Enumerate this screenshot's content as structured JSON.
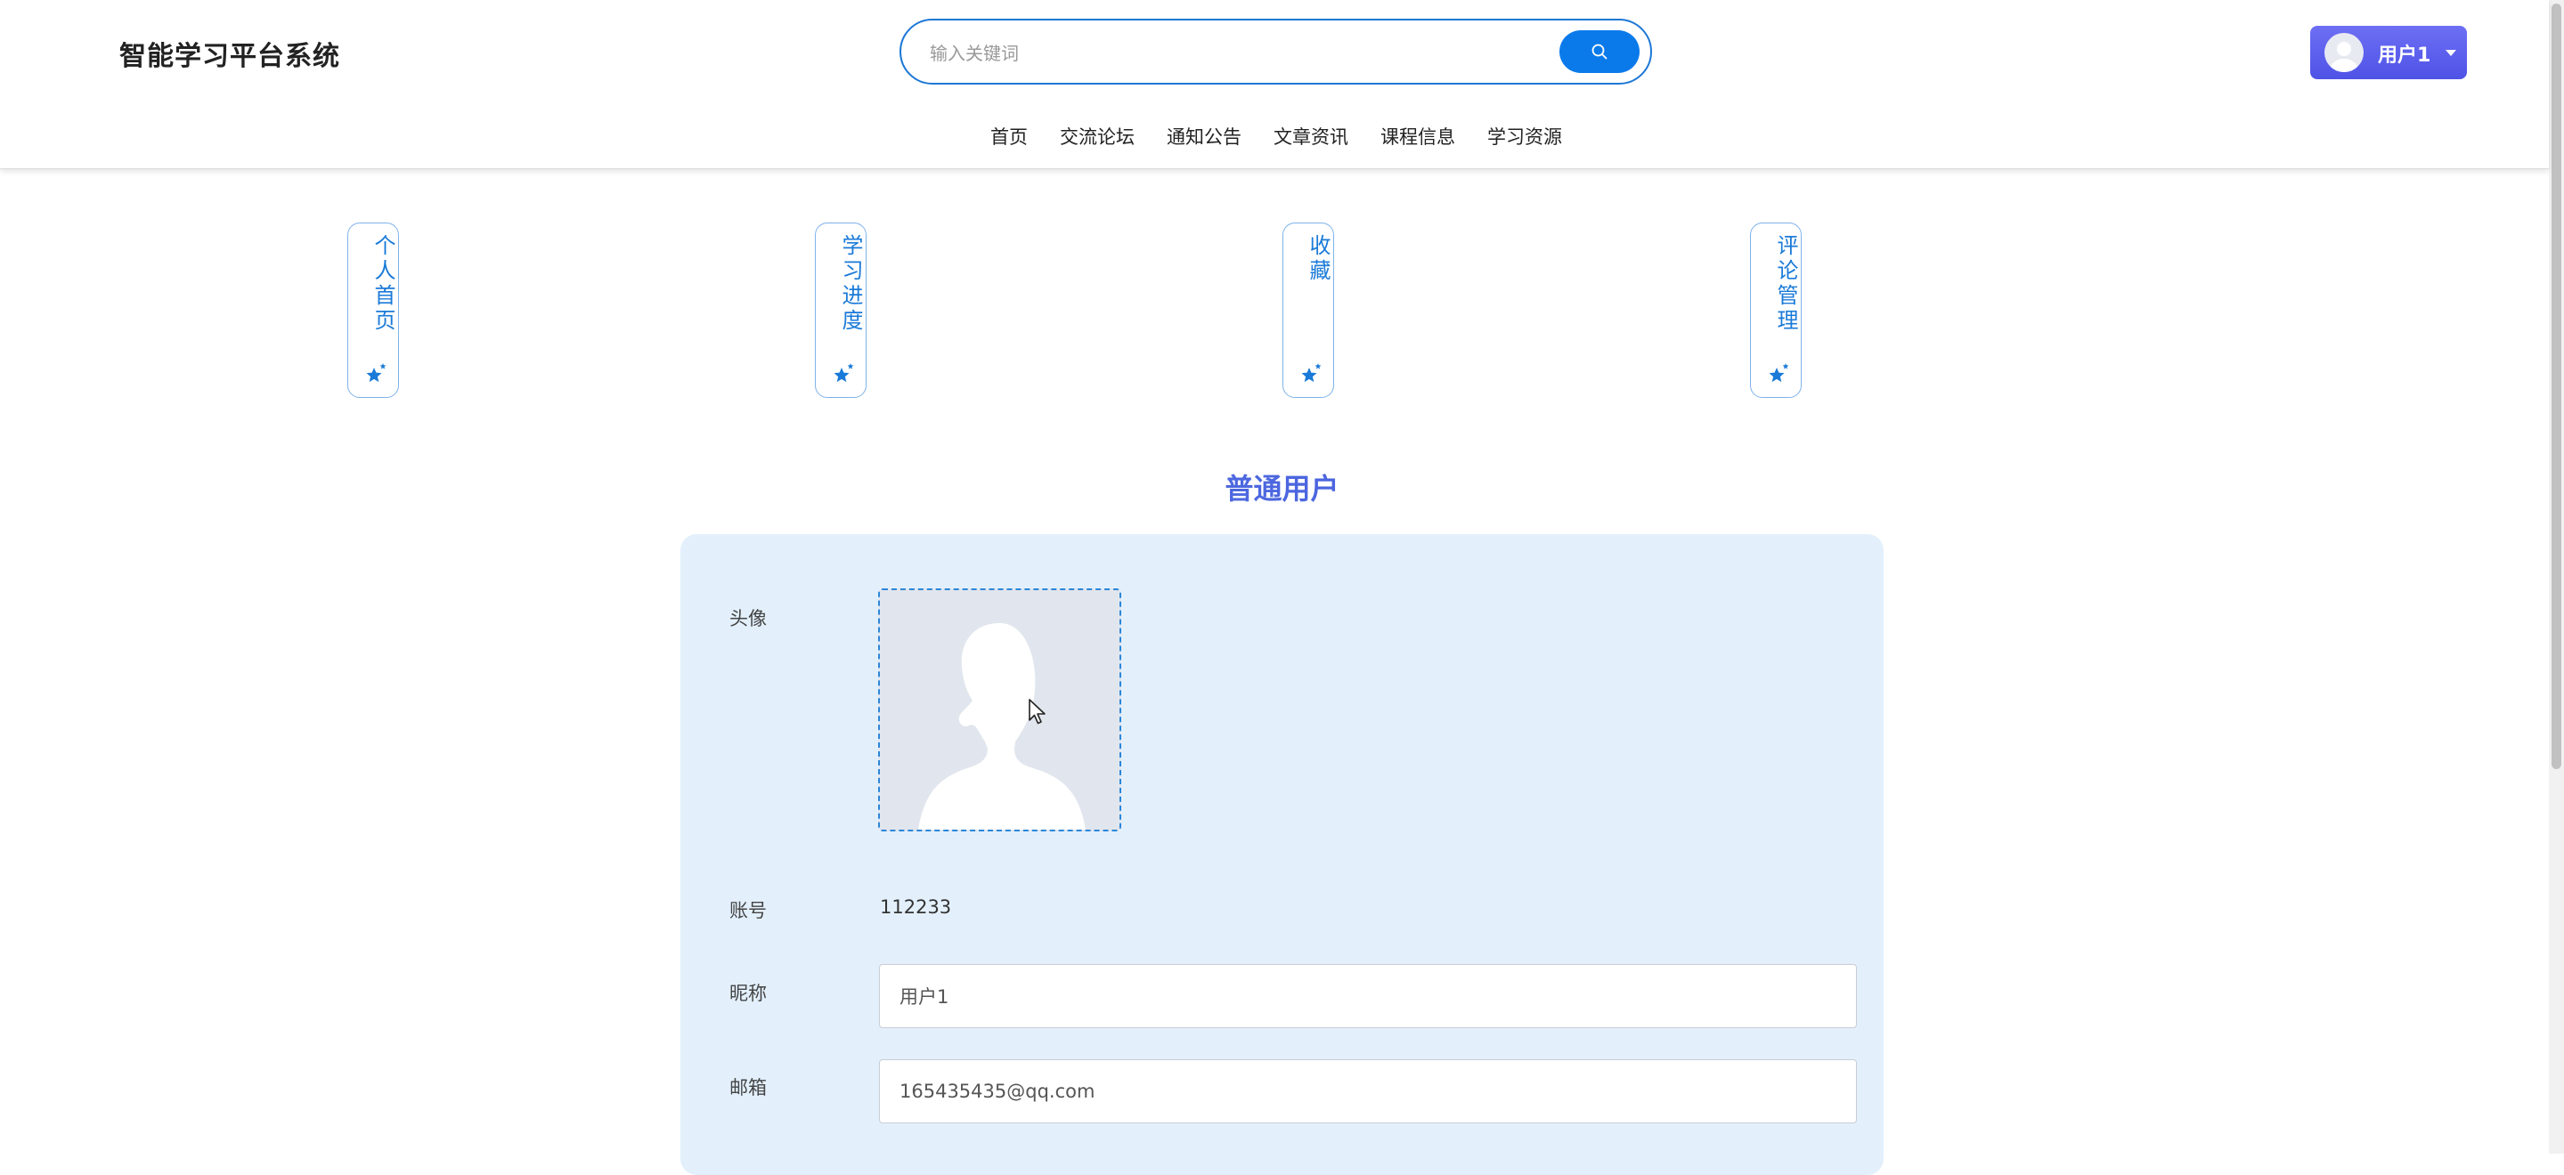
{
  "header": {
    "site_title": "智能学习平台系统",
    "search_placeholder": "输入关键词",
    "user_menu_label": "用户1"
  },
  "nav": {
    "items": [
      "首页",
      "交流论坛",
      "通知公告",
      "文章资讯",
      "课程信息",
      "学习资源"
    ]
  },
  "side_tabs": [
    {
      "label": "个人首页"
    },
    {
      "label": "学习进度"
    },
    {
      "label": "收藏"
    },
    {
      "label": "评论管理"
    }
  ],
  "page_heading": "普通用户",
  "form": {
    "avatar_label": "头像",
    "account_label": "账号",
    "account_value": "112233",
    "nickname_label": "昵称",
    "nickname_value": "用户1",
    "email_label": "邮箱",
    "email_value": "165435435@qq.com"
  },
  "colors": {
    "accent": "#0a7aeb",
    "user_menu": "#5a5ded",
    "panel_bg": "#e3f0fc",
    "tab_text": "#1a7ad8"
  }
}
